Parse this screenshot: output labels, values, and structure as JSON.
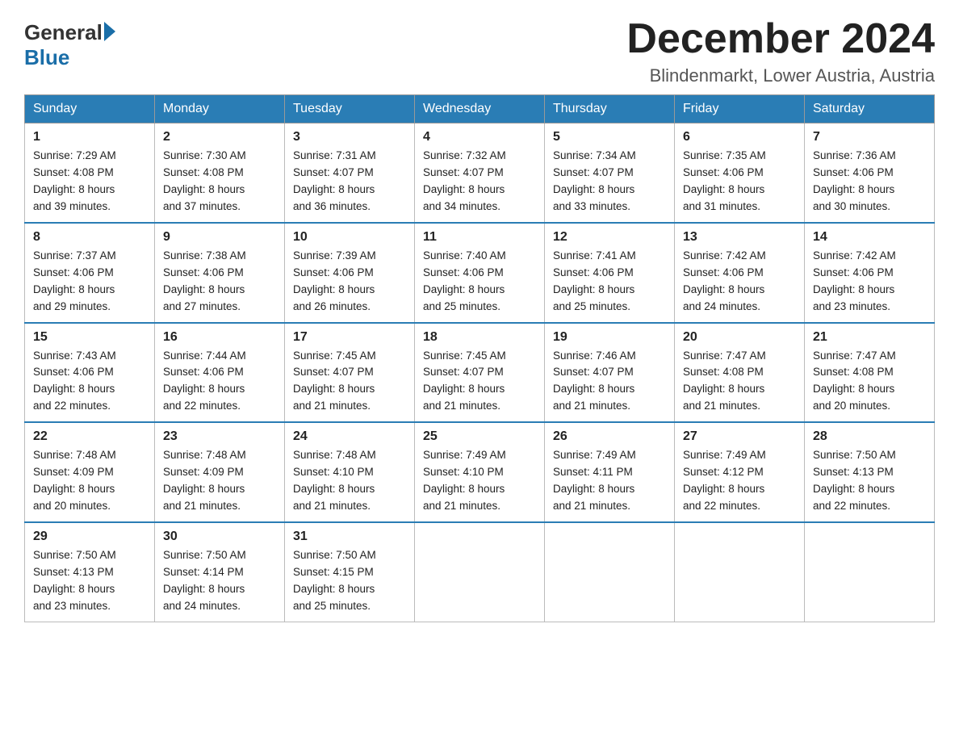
{
  "header": {
    "logo_general": "General",
    "logo_blue": "Blue",
    "month_title": "December 2024",
    "location": "Blindenmarkt, Lower Austria, Austria"
  },
  "weekdays": [
    "Sunday",
    "Monday",
    "Tuesday",
    "Wednesday",
    "Thursday",
    "Friday",
    "Saturday"
  ],
  "weeks": [
    [
      {
        "day": "1",
        "sunrise": "7:29 AM",
        "sunset": "4:08 PM",
        "daylight": "8 hours and 39 minutes."
      },
      {
        "day": "2",
        "sunrise": "7:30 AM",
        "sunset": "4:08 PM",
        "daylight": "8 hours and 37 minutes."
      },
      {
        "day": "3",
        "sunrise": "7:31 AM",
        "sunset": "4:07 PM",
        "daylight": "8 hours and 36 minutes."
      },
      {
        "day": "4",
        "sunrise": "7:32 AM",
        "sunset": "4:07 PM",
        "daylight": "8 hours and 34 minutes."
      },
      {
        "day": "5",
        "sunrise": "7:34 AM",
        "sunset": "4:07 PM",
        "daylight": "8 hours and 33 minutes."
      },
      {
        "day": "6",
        "sunrise": "7:35 AM",
        "sunset": "4:06 PM",
        "daylight": "8 hours and 31 minutes."
      },
      {
        "day": "7",
        "sunrise": "7:36 AM",
        "sunset": "4:06 PM",
        "daylight": "8 hours and 30 minutes."
      }
    ],
    [
      {
        "day": "8",
        "sunrise": "7:37 AM",
        "sunset": "4:06 PM",
        "daylight": "8 hours and 29 minutes."
      },
      {
        "day": "9",
        "sunrise": "7:38 AM",
        "sunset": "4:06 PM",
        "daylight": "8 hours and 27 minutes."
      },
      {
        "day": "10",
        "sunrise": "7:39 AM",
        "sunset": "4:06 PM",
        "daylight": "8 hours and 26 minutes."
      },
      {
        "day": "11",
        "sunrise": "7:40 AM",
        "sunset": "4:06 PM",
        "daylight": "8 hours and 25 minutes."
      },
      {
        "day": "12",
        "sunrise": "7:41 AM",
        "sunset": "4:06 PM",
        "daylight": "8 hours and 25 minutes."
      },
      {
        "day": "13",
        "sunrise": "7:42 AM",
        "sunset": "4:06 PM",
        "daylight": "8 hours and 24 minutes."
      },
      {
        "day": "14",
        "sunrise": "7:42 AM",
        "sunset": "4:06 PM",
        "daylight": "8 hours and 23 minutes."
      }
    ],
    [
      {
        "day": "15",
        "sunrise": "7:43 AM",
        "sunset": "4:06 PM",
        "daylight": "8 hours and 22 minutes."
      },
      {
        "day": "16",
        "sunrise": "7:44 AM",
        "sunset": "4:06 PM",
        "daylight": "8 hours and 22 minutes."
      },
      {
        "day": "17",
        "sunrise": "7:45 AM",
        "sunset": "4:07 PM",
        "daylight": "8 hours and 21 minutes."
      },
      {
        "day": "18",
        "sunrise": "7:45 AM",
        "sunset": "4:07 PM",
        "daylight": "8 hours and 21 minutes."
      },
      {
        "day": "19",
        "sunrise": "7:46 AM",
        "sunset": "4:07 PM",
        "daylight": "8 hours and 21 minutes."
      },
      {
        "day": "20",
        "sunrise": "7:47 AM",
        "sunset": "4:08 PM",
        "daylight": "8 hours and 21 minutes."
      },
      {
        "day": "21",
        "sunrise": "7:47 AM",
        "sunset": "4:08 PM",
        "daylight": "8 hours and 20 minutes."
      }
    ],
    [
      {
        "day": "22",
        "sunrise": "7:48 AM",
        "sunset": "4:09 PM",
        "daylight": "8 hours and 20 minutes."
      },
      {
        "day": "23",
        "sunrise": "7:48 AM",
        "sunset": "4:09 PM",
        "daylight": "8 hours and 21 minutes."
      },
      {
        "day": "24",
        "sunrise": "7:48 AM",
        "sunset": "4:10 PM",
        "daylight": "8 hours and 21 minutes."
      },
      {
        "day": "25",
        "sunrise": "7:49 AM",
        "sunset": "4:10 PM",
        "daylight": "8 hours and 21 minutes."
      },
      {
        "day": "26",
        "sunrise": "7:49 AM",
        "sunset": "4:11 PM",
        "daylight": "8 hours and 21 minutes."
      },
      {
        "day": "27",
        "sunrise": "7:49 AM",
        "sunset": "4:12 PM",
        "daylight": "8 hours and 22 minutes."
      },
      {
        "day": "28",
        "sunrise": "7:50 AM",
        "sunset": "4:13 PM",
        "daylight": "8 hours and 22 minutes."
      }
    ],
    [
      {
        "day": "29",
        "sunrise": "7:50 AM",
        "sunset": "4:13 PM",
        "daylight": "8 hours and 23 minutes."
      },
      {
        "day": "30",
        "sunrise": "7:50 AM",
        "sunset": "4:14 PM",
        "daylight": "8 hours and 24 minutes."
      },
      {
        "day": "31",
        "sunrise": "7:50 AM",
        "sunset": "4:15 PM",
        "daylight": "8 hours and 25 minutes."
      },
      null,
      null,
      null,
      null
    ]
  ],
  "labels": {
    "sunrise_prefix": "Sunrise: ",
    "sunset_prefix": "Sunset: ",
    "daylight_prefix": "Daylight: "
  }
}
